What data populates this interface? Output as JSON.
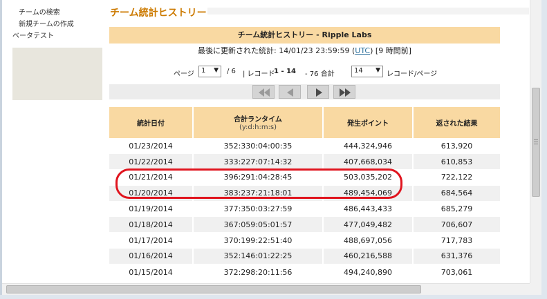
{
  "sidebar": {
    "items": [
      {
        "label": "チームの検索"
      },
      {
        "label": "新規チームの作成"
      },
      {
        "label": "ベータテスト"
      }
    ]
  },
  "page": {
    "title": "チーム統計ヒストリー"
  },
  "panel": {
    "header": "チーム統計ヒストリー - Ripple Labs",
    "updated_prefix": "最後に更新された統計: 14/01/23 23:59:59 (",
    "utc_link": "UTC",
    "updated_suffix": ") [9 時間前]"
  },
  "pager": {
    "page_label": "ページ",
    "page_value": "1",
    "of_pages": "/ 6",
    "record_label": "| レコード",
    "record_range": "1 - 14",
    "record_total": "- 76 合計",
    "per_page_value": "14",
    "per_page_label": "レコード/ページ"
  },
  "table": {
    "headers": {
      "date": "統計日付",
      "runtime": "合計ランタイム",
      "runtime_sub": "(y:d:h:m:s)",
      "points": "発生ポイント",
      "results": "返された結果"
    },
    "rows": [
      {
        "date": "01/23/2014",
        "runtime": "352:330:04:00:35",
        "points": "444,324,946",
        "results": "613,920"
      },
      {
        "date": "01/22/2014",
        "runtime": "333:227:07:14:32",
        "points": "407,668,034",
        "results": "610,853"
      },
      {
        "date": "01/21/2014",
        "runtime": "396:291:04:28:45",
        "points": "503,035,202",
        "results": "722,122"
      },
      {
        "date": "01/20/2014",
        "runtime": "383:237:21:18:01",
        "points": "489,454,069",
        "results": "684,564"
      },
      {
        "date": "01/19/2014",
        "runtime": "377:350:03:27:59",
        "points": "486,443,433",
        "results": "685,279"
      },
      {
        "date": "01/18/2014",
        "runtime": "367:059:05:01:57",
        "points": "477,049,482",
        "results": "706,607"
      },
      {
        "date": "01/17/2014",
        "runtime": "370:199:22:51:40",
        "points": "488,697,056",
        "results": "717,783"
      },
      {
        "date": "01/16/2014",
        "runtime": "352:146:01:22:25",
        "points": "460,216,588",
        "results": "631,376"
      },
      {
        "date": "01/15/2014",
        "runtime": "372:298:20:11:56",
        "points": "494,240,890",
        "results": "703,061"
      }
    ]
  },
  "colors": {
    "accent": "#cc7a00",
    "header_bg": "#f9d9a2",
    "highlight": "#e0141e",
    "link": "#2a6f9b"
  }
}
